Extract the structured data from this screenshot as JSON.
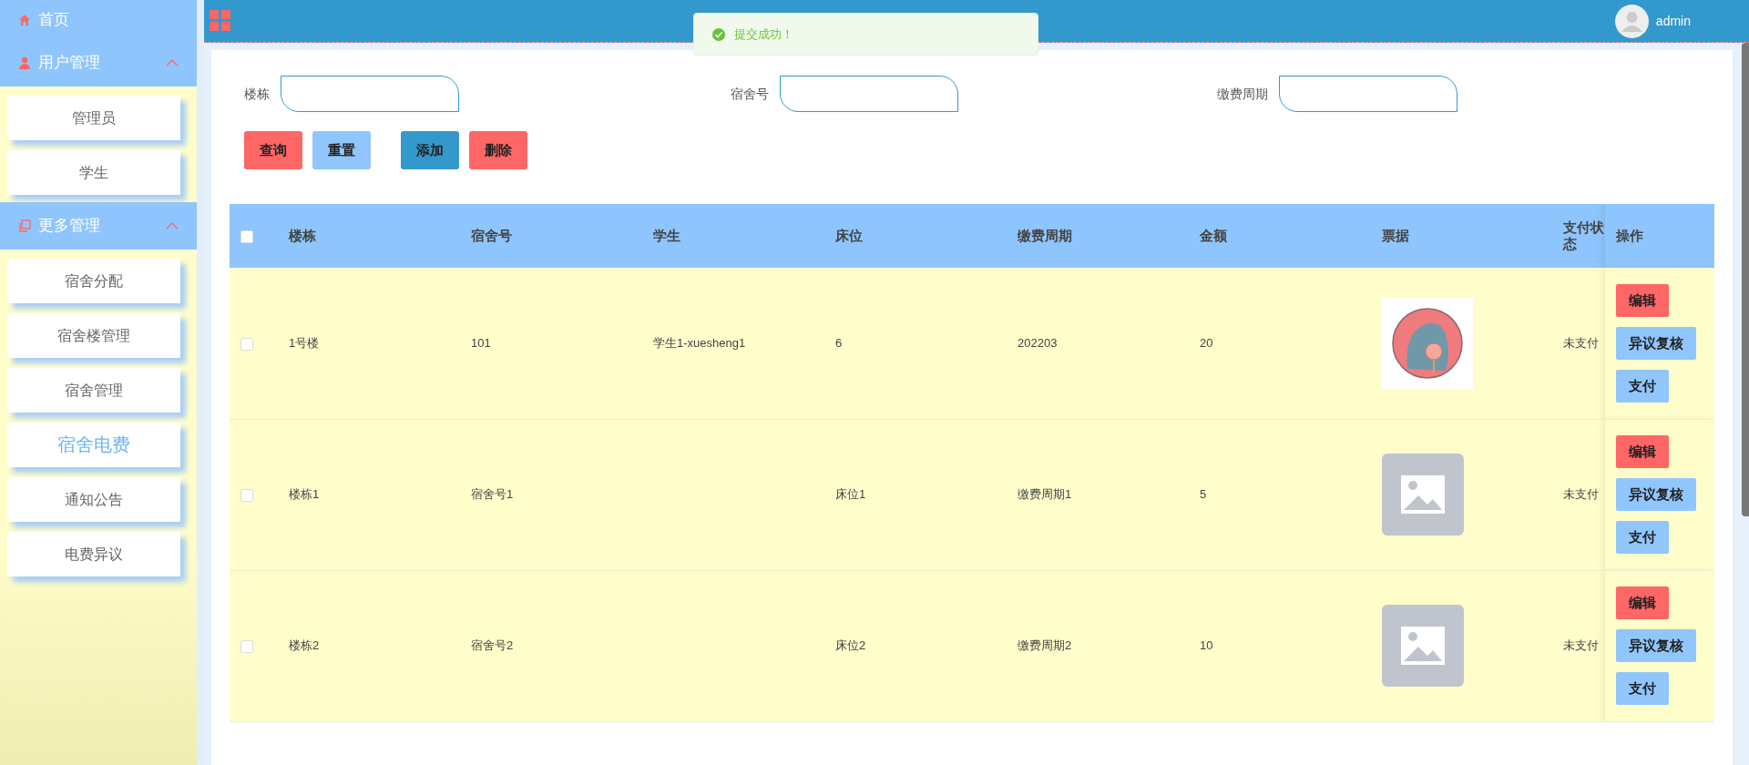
{
  "sidebar": {
    "items": [
      {
        "kind": "link",
        "label": "首页"
      },
      {
        "kind": "group",
        "label": "用户管理",
        "expanded": true,
        "children": [
          {
            "label": "管理员",
            "selected": false
          },
          {
            "label": "学生",
            "selected": false
          }
        ]
      },
      {
        "kind": "group",
        "label": "更多管理",
        "expanded": true,
        "children": [
          {
            "label": "宿舍分配",
            "selected": false
          },
          {
            "label": "宿舍楼管理",
            "selected": false
          },
          {
            "label": "宿舍管理",
            "selected": false
          },
          {
            "label": "宿舍电费",
            "selected": true
          },
          {
            "label": "通知公告",
            "selected": false
          },
          {
            "label": "电费异议",
            "selected": false
          }
        ]
      }
    ]
  },
  "topbar": {
    "toast": "提交成功！",
    "user": "admin"
  },
  "filters": [
    {
      "label": "楼栋"
    },
    {
      "label": "宿舍号"
    },
    {
      "label": "缴费周期"
    }
  ],
  "buttons": [
    {
      "label": "查询",
      "kind": "red"
    },
    {
      "label": "重置",
      "kind": "light"
    },
    {
      "label": "添加",
      "kind": "blue"
    },
    {
      "label": "删除",
      "kind": "red"
    }
  ],
  "table": {
    "all_checked": false,
    "columns": [
      "楼栋",
      "宿舍号",
      "学生",
      "床位",
      "缴费周期",
      "金额",
      "票据",
      "支付状态",
      "操作"
    ],
    "rows": [
      {
        "checked": false,
        "cells": [
          "1号楼",
          "101",
          "学生1-xuesheng1",
          "6",
          "202203",
          "20"
        ],
        "receipt": {
          "kind": "illustration"
        },
        "status": "未支付",
        "actions": [
          {
            "label": "编辑",
            "kind": "red"
          },
          {
            "label": "异议复核",
            "kind": "light"
          },
          {
            "label": "支付",
            "kind": "light"
          }
        ]
      },
      {
        "checked": false,
        "cells": [
          "楼栋1",
          "宿舍号1",
          "",
          "床位1",
          "缴费周期1",
          "5"
        ],
        "receipt": {
          "kind": "placeholder"
        },
        "status": "未支付",
        "actions": [
          {
            "label": "编辑",
            "kind": "red"
          },
          {
            "label": "异议复核",
            "kind": "light"
          },
          {
            "label": "支付",
            "kind": "light"
          }
        ]
      },
      {
        "checked": false,
        "cells": [
          "楼栋2",
          "宿舍号2",
          "",
          "床位2",
          "缴费周期2",
          "10"
        ],
        "receipt": {
          "kind": "placeholder"
        },
        "status": "未支付",
        "actions": [
          {
            "label": "编辑",
            "kind": "red"
          },
          {
            "label": "异议复核",
            "kind": "light"
          },
          {
            "label": "支付",
            "kind": "light"
          }
        ]
      }
    ]
  }
}
